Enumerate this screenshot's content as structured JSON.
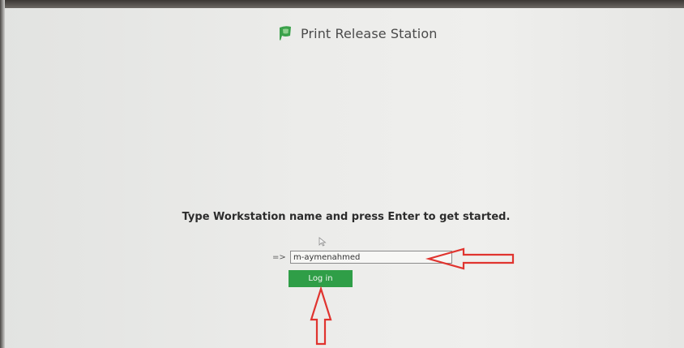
{
  "app": {
    "title": "Print Release Station",
    "logo_icon": "papercut-leaf-icon",
    "logo_color": "#3aa14a"
  },
  "main": {
    "prompt": "Type Workstation name and press Enter to get started.",
    "input_prefix": "=>",
    "workstation_value": "m-aymenahmed",
    "login_label": "Log in",
    "login_color": "#2f9e47"
  },
  "annotations": {
    "arrow_color": "#e0342f",
    "arrows": [
      "left-pointing-arrow-icon",
      "up-pointing-arrow-icon"
    ]
  }
}
